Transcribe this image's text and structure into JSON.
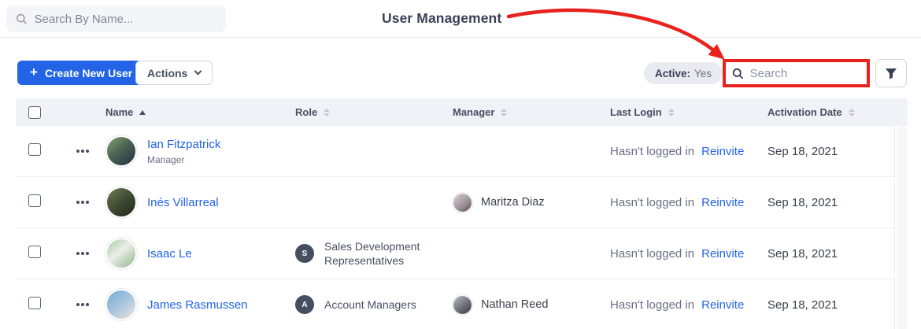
{
  "topbar": {
    "search_placeholder": "Search By Name..."
  },
  "annotation": {
    "title": "User Management",
    "arrow_color": "#E8231D"
  },
  "toolbar": {
    "create_button": "Create New User",
    "plus_glyph": "+",
    "actions_button": "Actions",
    "active_filter": {
      "label": "Active:",
      "value": "Yes"
    },
    "search_placeholder": "Search"
  },
  "table": {
    "columns": [
      {
        "label": "",
        "type": "checkbox"
      },
      {
        "label": "",
        "type": "row-menu"
      },
      {
        "label": "Name",
        "sort": "asc"
      },
      {
        "label": "Role",
        "sort": "none"
      },
      {
        "label": "Manager",
        "sort": "none"
      },
      {
        "label": "Last Login",
        "sort": "none"
      },
      {
        "label": "Activation Date",
        "sort": "none"
      }
    ],
    "rows": [
      {
        "name": "Ian Fitzpatrick",
        "name_subtitle": "Manager",
        "role_badge": "",
        "role_label": "",
        "manager_name": "",
        "last_login": "Hasn't logged in",
        "action_link": "Reinvite",
        "activation_date": "Sep 18, 2021"
      },
      {
        "name": "Inés Villarreal",
        "name_subtitle": "",
        "role_badge": "",
        "role_label": "",
        "manager_name": "Maritza Diaz",
        "last_login": "Hasn't logged in",
        "action_link": "Reinvite",
        "activation_date": "Sep 18, 2021"
      },
      {
        "name": "Isaac Le",
        "name_subtitle": "",
        "role_badge": "S",
        "role_label": "Sales Development Representatives",
        "manager_name": "",
        "last_login": "Hasn't logged in",
        "action_link": "Reinvite",
        "activation_date": "Sep 18, 2021"
      },
      {
        "name": "James Rasmussen",
        "name_subtitle": "",
        "role_badge": "A",
        "role_label": "Account Managers",
        "manager_name": "Nathan Reed",
        "last_login": "Hasn't logged in",
        "action_link": "Reinvite",
        "activation_date": "Sep 18, 2021"
      }
    ]
  },
  "colors": {
    "primary_blue": "#2264E5",
    "annotation_red": "#E8231D",
    "header_bg": "#F1F2F8",
    "text_dark": "#464F60",
    "text_gray": "#687182",
    "link_blue": "#2264E5"
  },
  "icons": {
    "topbar_search": "magnifier-icon",
    "toolbar_search": "magnifier-icon",
    "filter": "funnel-icon",
    "create": "plus-icon",
    "actions": "chevron-down-icon",
    "row_menu": "ellipsis-icon",
    "name_sort": "sort-asc-icon",
    "other_sort": "sort-both-icon"
  }
}
